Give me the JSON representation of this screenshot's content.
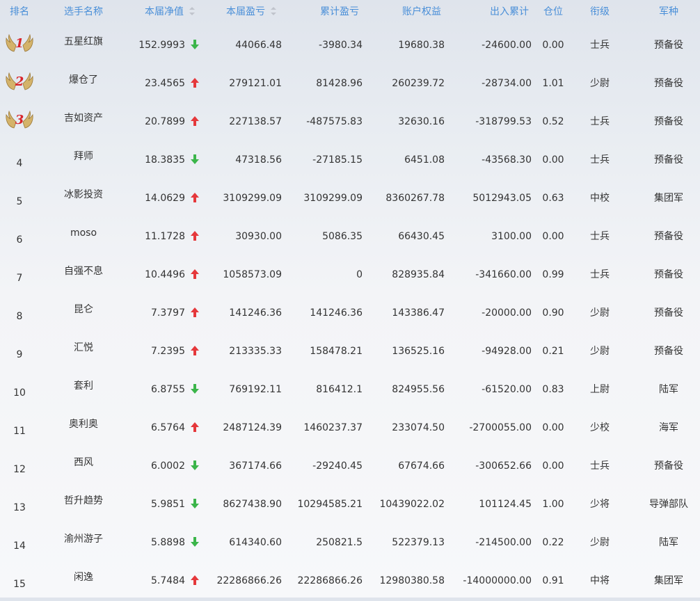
{
  "headers": {
    "rank": "排名",
    "name": "选手名称",
    "nav": "本届净值",
    "pnl": "本届盈亏",
    "cum_pnl": "累计盈亏",
    "equity": "账户权益",
    "inout": "出入累计",
    "position": "仓位",
    "military_rank": "衔级",
    "arm": "军种"
  },
  "colors": {
    "header_text": "#4a8fd8",
    "up": "#e5383b",
    "down": "#3bb54a",
    "medal_gold": "#d4b36a",
    "medal_number": "#d8242b"
  },
  "rows": [
    {
      "rank": "1",
      "medal": true,
      "name": "五星红旗",
      "nav": "152.9993",
      "trend": "down",
      "pnl": "44066.48",
      "cum": "-3980.34",
      "equity": "19680.38",
      "io": "-24600.00",
      "pos": "0.00",
      "rk": "士兵",
      "arm": "预备役"
    },
    {
      "rank": "2",
      "medal": true,
      "name": "爆仓了",
      "nav": "23.4565",
      "trend": "up",
      "pnl": "279121.01",
      "cum": "81428.96",
      "equity": "260239.72",
      "io": "-28734.00",
      "pos": "1.01",
      "rk": "少尉",
      "arm": "预备役"
    },
    {
      "rank": "3",
      "medal": true,
      "name": "吉如资产",
      "nav": "20.7899",
      "trend": "up",
      "pnl": "227138.57",
      "cum": "-487575.83",
      "equity": "32630.16",
      "io": "-318799.53",
      "pos": "0.52",
      "rk": "士兵",
      "arm": "预备役"
    },
    {
      "rank": "4",
      "name": "拜师",
      "nav": "18.3835",
      "trend": "down",
      "pnl": "47318.56",
      "cum": "-27185.15",
      "equity": "6451.08",
      "io": "-43568.30",
      "pos": "0.00",
      "rk": "士兵",
      "arm": "预备役"
    },
    {
      "rank": "5",
      "name": "冰影投资",
      "nav": "14.0629",
      "trend": "up",
      "pnl": "3109299.09",
      "cum": "3109299.09",
      "equity": "8360267.78",
      "io": "5012943.05",
      "pos": "0.63",
      "rk": "中校",
      "arm": "集团军"
    },
    {
      "rank": "6",
      "name": "moso",
      "nav": "11.1728",
      "trend": "up",
      "pnl": "30930.00",
      "cum": "5086.35",
      "equity": "66430.45",
      "io": "3100.00",
      "pos": "0.00",
      "rk": "士兵",
      "arm": "预备役"
    },
    {
      "rank": "7",
      "name": "自强不息",
      "nav": "10.4496",
      "trend": "up",
      "pnl": "1058573.09",
      "cum": "0",
      "equity": "828935.84",
      "io": "-341660.00",
      "pos": "0.99",
      "rk": "士兵",
      "arm": "预备役"
    },
    {
      "rank": "8",
      "name": "昆仑",
      "nav": "7.3797",
      "trend": "up",
      "pnl": "141246.36",
      "cum": "141246.36",
      "equity": "143386.47",
      "io": "-20000.00",
      "pos": "0.90",
      "rk": "少尉",
      "arm": "预备役"
    },
    {
      "rank": "9",
      "name": "汇悦",
      "nav": "7.2395",
      "trend": "up",
      "pnl": "213335.33",
      "cum": "158478.21",
      "equity": "136525.16",
      "io": "-94928.00",
      "pos": "0.21",
      "rk": "少尉",
      "arm": "预备役"
    },
    {
      "rank": "10",
      "name": "套利",
      "nav": "6.8755",
      "trend": "down",
      "pnl": "769192.11",
      "cum": "816412.1",
      "equity": "824955.56",
      "io": "-61520.00",
      "pos": "0.83",
      "rk": "上尉",
      "arm": "陆军"
    },
    {
      "rank": "11",
      "name": "奥利奥",
      "nav": "6.5764",
      "trend": "up",
      "pnl": "2487124.39",
      "cum": "1460237.37",
      "equity": "233074.50",
      "io": "-2700055.00",
      "pos": "0.00",
      "rk": "少校",
      "arm": "海军"
    },
    {
      "rank": "12",
      "name": "西风",
      "nav": "6.0002",
      "trend": "down",
      "pnl": "367174.66",
      "cum": "-29240.45",
      "equity": "67674.66",
      "io": "-300652.66",
      "pos": "0.00",
      "rk": "士兵",
      "arm": "预备役"
    },
    {
      "rank": "13",
      "name": "哲升趋势",
      "nav": "5.9851",
      "trend": "down",
      "pnl": "8627438.90",
      "cum": "10294585.21",
      "equity": "10439022.02",
      "io": "101124.45",
      "pos": "1.00",
      "rk": "少将",
      "arm": "导弹部队"
    },
    {
      "rank": "14",
      "name": "渝州游子",
      "nav": "5.8898",
      "trend": "down",
      "pnl": "614340.60",
      "cum": "250821.5",
      "equity": "522379.13",
      "io": "-214500.00",
      "pos": "0.22",
      "rk": "少尉",
      "arm": "陆军"
    },
    {
      "rank": "15",
      "name": "闲逸",
      "nav": "5.7484",
      "trend": "up",
      "pnl": "22286866.26",
      "cum": "22286866.26",
      "equity": "12980380.58",
      "io": "-14000000.00",
      "pos": "0.91",
      "rk": "中将",
      "arm": "集团军"
    }
  ]
}
